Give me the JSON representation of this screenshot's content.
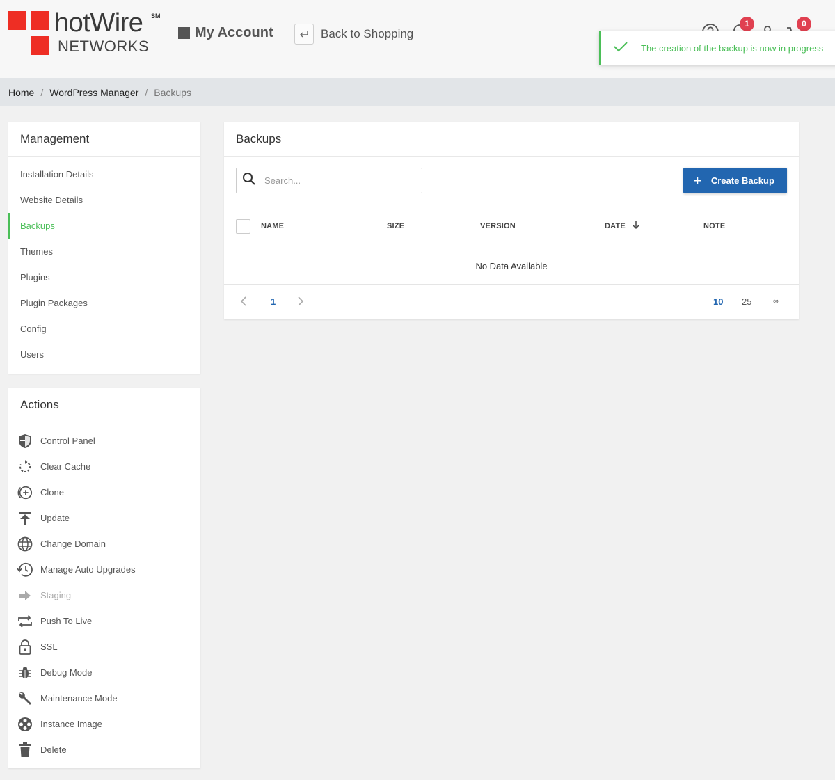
{
  "header": {
    "logo_brand": "hotWire",
    "logo_sm": "SM",
    "logo_networks": "NETWORKS",
    "my_account": "My Account",
    "back_to_shopping": "Back to Shopping",
    "notifications_count": "1",
    "cart_count": "0"
  },
  "toast": {
    "message": "The creation of the backup is now in progress",
    "color": "#4bbf58"
  },
  "breadcrumb": {
    "items": [
      "Home",
      "WordPress Manager",
      "Backups"
    ],
    "separator": "/"
  },
  "management": {
    "title": "Management",
    "items": [
      {
        "label": "Installation Details"
      },
      {
        "label": "Website Details"
      },
      {
        "label": "Backups",
        "active": true
      },
      {
        "label": "Themes"
      },
      {
        "label": "Plugins"
      },
      {
        "label": "Plugin Packages"
      },
      {
        "label": "Config"
      },
      {
        "label": "Users"
      }
    ]
  },
  "actions": {
    "title": "Actions",
    "items": [
      {
        "label": "Control Panel",
        "icon": "shield-icon"
      },
      {
        "label": "Clear Cache",
        "icon": "refresh-icon"
      },
      {
        "label": "Clone",
        "icon": "clone-icon"
      },
      {
        "label": "Update",
        "icon": "upload-icon"
      },
      {
        "label": "Change Domain",
        "icon": "globe-icon"
      },
      {
        "label": "Manage Auto Upgrades",
        "icon": "history-icon"
      },
      {
        "label": "Staging",
        "icon": "arrow-right-icon",
        "disabled": true
      },
      {
        "label": "Push To Live",
        "icon": "repeat-icon"
      },
      {
        "label": "SSL",
        "icon": "lock-icon"
      },
      {
        "label": "Debug Mode",
        "icon": "bug-icon"
      },
      {
        "label": "Maintenance Mode",
        "icon": "wrench-icon"
      },
      {
        "label": "Instance Image",
        "icon": "film-icon"
      },
      {
        "label": "Delete",
        "icon": "trash-icon"
      }
    ]
  },
  "backups": {
    "title": "Backups",
    "search_placeholder": "Search...",
    "create_label": "Create Backup",
    "columns": [
      "NAME",
      "SIZE",
      "VERSION",
      "DATE",
      "NOTE"
    ],
    "empty_text": "No Data Available",
    "current_page": "1",
    "page_sizes": [
      "10",
      "25",
      "∞"
    ],
    "selected_page_size": "10"
  },
  "colors": {
    "accent_green": "#4bbf58",
    "primary_blue": "#2266b0",
    "brand_red": "#ee2e24",
    "badge_red": "#e04050"
  }
}
